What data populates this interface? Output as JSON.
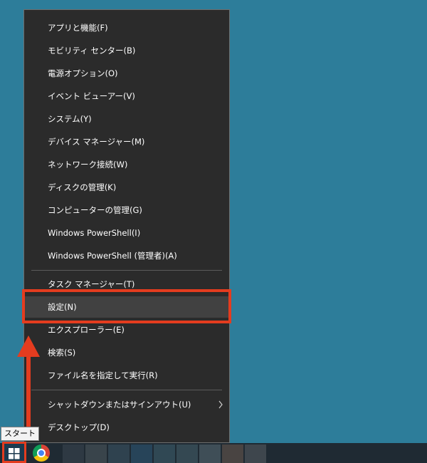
{
  "menu": {
    "items": [
      {
        "label": "アプリと機能(F)"
      },
      {
        "label": "モビリティ センター(B)"
      },
      {
        "label": "電源オプション(O)"
      },
      {
        "label": "イベント ビューアー(V)"
      },
      {
        "label": "システム(Y)"
      },
      {
        "label": "デバイス マネージャー(M)"
      },
      {
        "label": "ネットワーク接続(W)"
      },
      {
        "label": "ディスクの管理(K)"
      },
      {
        "label": "コンピューターの管理(G)"
      },
      {
        "label": "Windows PowerShell(I)"
      },
      {
        "label": "Windows PowerShell (管理者)(A)"
      },
      {
        "label": "タスク マネージャー(T)"
      },
      {
        "label": "設定(N)"
      },
      {
        "label": "エクスプローラー(E)"
      },
      {
        "label": "検索(S)"
      },
      {
        "label": "ファイル名を指定して実行(R)"
      },
      {
        "label": "シャットダウンまたはサインアウト(U)"
      },
      {
        "label": "デスクトップ(D)"
      }
    ],
    "submenu_icon": "chevron-right-icon"
  },
  "taskbar": {
    "start_tooltip": "スタート",
    "apps": [
      "chrome-icon"
    ]
  },
  "colors": {
    "desktop": "#2d7d9a",
    "menu_bg": "#2b2b2b",
    "highlight_row": "#414141",
    "annotation": "#e43c1f"
  }
}
